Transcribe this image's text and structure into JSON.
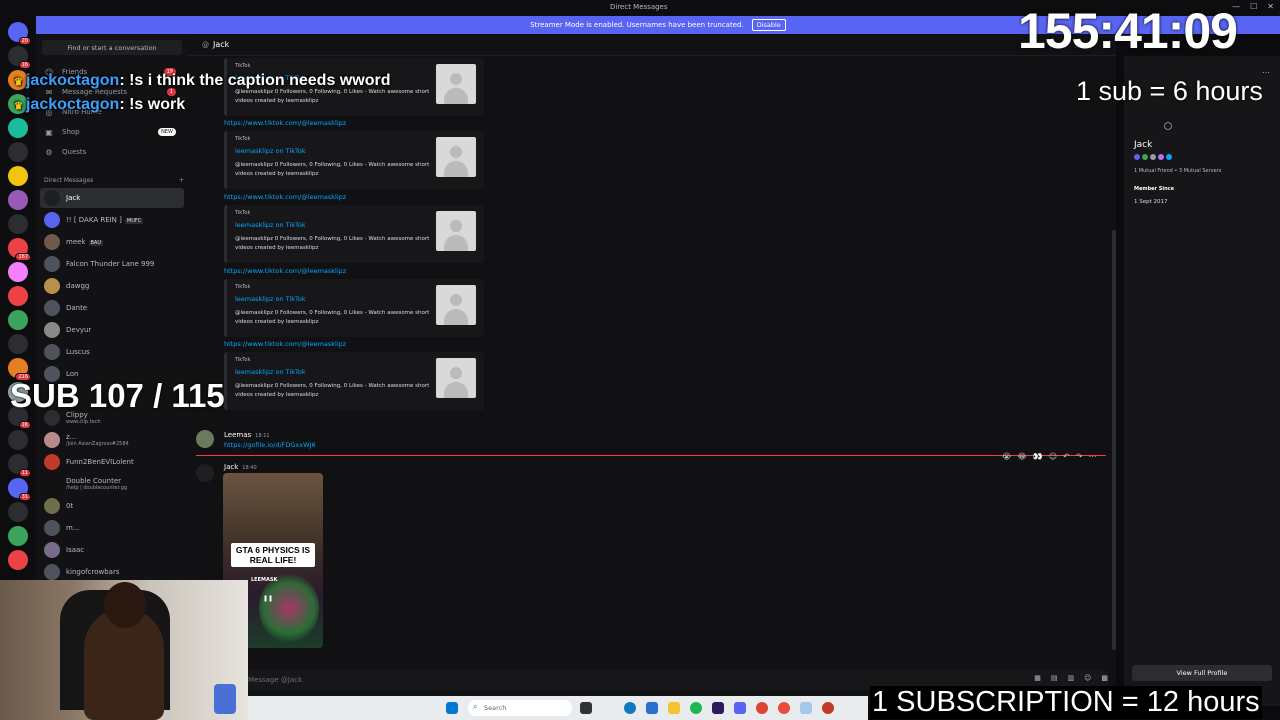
{
  "window": {
    "title": "Direct Messages"
  },
  "banner": {
    "text": "Streamer Mode is enabled. Usernames have been truncated.",
    "disable_label": "Disable"
  },
  "servers": [
    {
      "label": "",
      "color": "#5865f2",
      "badge": "20"
    },
    {
      "label": "",
      "color": "#2b2d31",
      "badge": "16"
    },
    {
      "label": "",
      "color": "#e67e22",
      "badge": ""
    },
    {
      "label": "",
      "color": "#3ba55d",
      "badge": ""
    },
    {
      "label": "",
      "color": "#1abc9c",
      "badge": ""
    },
    {
      "label": "",
      "color": "#2b2d31",
      "badge": ""
    },
    {
      "label": "",
      "color": "#f1c40f",
      "badge": ""
    },
    {
      "label": "",
      "color": "#9b59b6",
      "badge": ""
    },
    {
      "label": "",
      "color": "#2b2d31",
      "badge": ""
    },
    {
      "label": "",
      "color": "#ed4245",
      "badge": "167"
    },
    {
      "label": "",
      "color": "#f47fff",
      "badge": ""
    },
    {
      "label": "",
      "color": "#ed4245",
      "badge": ""
    },
    {
      "label": "",
      "color": "#3ba55d",
      "badge": ""
    },
    {
      "label": "",
      "color": "#2b2d31",
      "badge": ""
    },
    {
      "label": "",
      "color": "#e67e22",
      "badge": "216"
    },
    {
      "label": "",
      "color": "#95a5a6",
      "badge": ""
    },
    {
      "label": "",
      "color": "#2b2d31",
      "badge": "1K"
    },
    {
      "label": "",
      "color": "#2b2d31",
      "badge": ""
    },
    {
      "label": "",
      "color": "#2b2d31",
      "badge": "11"
    },
    {
      "label": "",
      "color": "#5865f2",
      "badge": "31"
    },
    {
      "label": "",
      "color": "#2b2d31",
      "badge": ""
    },
    {
      "label": "",
      "color": "#3ba55d",
      "badge": ""
    },
    {
      "label": "",
      "color": "#ed4245",
      "badge": ""
    }
  ],
  "sidebar": {
    "find_label": "Find or start a conversation",
    "nav": [
      {
        "icon": "friends-icon",
        "glyph": "☺",
        "label": "Friends",
        "badge": "19"
      },
      {
        "icon": "message-requests-icon",
        "glyph": "✉",
        "label": "Message Requests",
        "badge": "1"
      },
      {
        "icon": "nitro-icon",
        "glyph": "◎",
        "label": "Nitro Home",
        "badge": ""
      },
      {
        "icon": "shop-icon",
        "glyph": "▣",
        "label": "Shop",
        "badge": "NEW"
      },
      {
        "icon": "quests-icon",
        "glyph": "⚙",
        "label": "Quests",
        "badge": ""
      }
    ],
    "dm_header": "Direct Messages",
    "dms": [
      {
        "name": "Jack",
        "sub": "",
        "tag": "",
        "color": "#1e1f22",
        "active": true
      },
      {
        "name": "!! [ DAKA REIN ]",
        "sub": "",
        "tag": "MUFC",
        "color": "#5865f2",
        "active": false
      },
      {
        "name": "meek",
        "sub": "",
        "tag": "BAU",
        "color": "#6d5a4a",
        "active": false
      },
      {
        "name": "Falcon Thunder Lane 999",
        "sub": "",
        "tag": "",
        "color": "#4f545c",
        "active": false
      },
      {
        "name": "dawgg",
        "sub": "",
        "tag": "",
        "color": "#b9904a",
        "active": false
      },
      {
        "name": "Dante",
        "sub": "",
        "tag": "",
        "color": "#4f545c",
        "active": false
      },
      {
        "name": "Devyur",
        "sub": "",
        "tag": "",
        "color": "#8a8a8a",
        "active": false
      },
      {
        "name": "Luscus",
        "sub": "",
        "tag": "",
        "color": "#4f545c",
        "active": false
      },
      {
        "name": "Lon",
        "sub": "",
        "tag": "",
        "color": "#4f545c",
        "active": false
      },
      {
        "name": "",
        "sub": "",
        "tag": "",
        "color": "#4f545c",
        "active": false
      },
      {
        "name": "Clippy",
        "sub": "www.clip.tech",
        "tag": "",
        "color": "#2b2d31",
        "active": false
      },
      {
        "name": "z...",
        "sub": "/join AsianZagross#2584",
        "tag": "",
        "color": "#b98a8a",
        "active": false
      },
      {
        "name": "Funn2BenEVILolent",
        "sub": "",
        "tag": "",
        "color": "#c0392b",
        "active": false
      },
      {
        "name": "Double Counter",
        "sub": "/help | doublecounter.gg",
        "tag": "",
        "color": "#111",
        "active": false
      },
      {
        "name": "0t",
        "sub": "",
        "tag": "",
        "color": "#6d6f4a",
        "active": false
      },
      {
        "name": "m...",
        "sub": "",
        "tag": "",
        "color": "#4f545c",
        "active": false
      },
      {
        "name": "Isaac",
        "sub": "",
        "tag": "",
        "color": "#7a6a8a",
        "active": false
      },
      {
        "name": "kingofcrowbars",
        "sub": "",
        "tag": "",
        "color": "#4f545c",
        "active": false
      }
    ]
  },
  "chat": {
    "recipient": "Jack",
    "link_url": "https://www.tiktok.com/@leemasklipz",
    "embeds": [
      {
        "provider": "TikTok",
        "title": "leemasklipz on TikTok",
        "desc": "@leemasklipz 0 Followers, 0 Following, 0 Likes - Watch awesome short videos created by leemasklipz"
      },
      {
        "provider": "TikTok",
        "title": "leemasklipz on TikTok",
        "desc": "@leemasklipz 0 Followers, 0 Following, 0 Likes - Watch awesome short videos created by leemasklipz"
      },
      {
        "provider": "TikTok",
        "title": "leemasklipz on TikTok",
        "desc": "@leemasklipz 0 Followers, 0 Following, 0 Likes - Watch awesome short videos created by leemasklipz"
      },
      {
        "provider": "TikTok",
        "title": "leemasklipz on TikTok",
        "desc": "@leemasklipz 0 Followers, 0 Following, 0 Likes - Watch awesome short videos created by leemasklipz"
      },
      {
        "provider": "TikTok",
        "title": "leemasklipz on TikTok",
        "desc": "@leemasklipz 0 Followers, 0 Following, 0 Likes - Watch awesome short videos created by leemasklipz"
      }
    ],
    "msg1": {
      "author": "Leemas",
      "time": "18:11",
      "link": "https://gofile.io/d/FDGxxWJ6"
    },
    "msg2": {
      "author": "Jack",
      "time": "18:40",
      "video_caption": "GTA 6 PHYSICS IS REAL LIFE!",
      "video_sticker": "LEEMASK"
    },
    "composer_placeholder": "Message @Jack"
  },
  "profile": {
    "name": "Jack",
    "mutual": "1 Mutual Friend • 3 Mutual Servers",
    "member_since_label": "Member Since",
    "member_since": "1 Sept 2017",
    "full_profile_label": "View Full Profile"
  },
  "taskbar": {
    "search_label": "Search"
  },
  "overlay": {
    "timer": "155:41:09",
    "sub_rate": "1 sub = 6 hours",
    "sub_count": "SUB 107 / 115",
    "sub_hours": "1 SUBSCRIPTION = 12 hours",
    "chat": [
      {
        "user": "jackoctagon",
        "text": ": !s i think the caption needs wword"
      },
      {
        "user": "jackoctagon",
        "text": ": !s work"
      }
    ]
  },
  "colors": {
    "accent": "#5865f2",
    "link": "#00a8fc",
    "danger": "#f23f43"
  }
}
